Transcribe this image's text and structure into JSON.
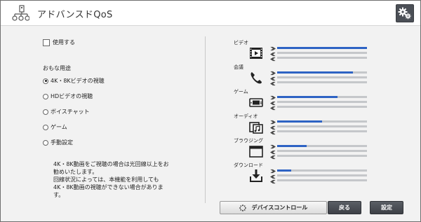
{
  "app": {
    "title": "アドバンスドQoS"
  },
  "settings": {
    "use_label": "使用する"
  },
  "purpose": {
    "title": "おもな用途",
    "options": [
      {
        "label": "4K・8Kビデオの視聴",
        "selected": true
      },
      {
        "label": "HDビデオの視聴",
        "selected": false
      },
      {
        "label": "ボイスチャット",
        "selected": false
      },
      {
        "label": "ゲーム",
        "selected": false
      },
      {
        "label": "手動設定",
        "selected": false
      }
    ]
  },
  "note": {
    "lines": [
      "4K・8K動画をご視聴の場合は光回線以上をお",
      "勧めいたします。",
      "回線状況によっては、本機能を利用しても",
      "4K・8K動画の視聴ができない場合がありま",
      "す。"
    ]
  },
  "categories": [
    {
      "label": "ビデオ",
      "icon": "video-icon",
      "level": 1.0
    },
    {
      "label": "会議",
      "icon": "phone-icon",
      "level": 0.84
    },
    {
      "label": "ゲーム",
      "icon": "game-icon",
      "level": 0.67
    },
    {
      "label": "オーディオ",
      "icon": "audio-icon",
      "level": 0.5
    },
    {
      "label": "ブラウジング",
      "icon": "browser-icon",
      "level": 0.33
    },
    {
      "label": "ダウンロード",
      "icon": "download-icon",
      "level": 0.16
    }
  ],
  "buttons": {
    "device_control": "デバイスコントロール",
    "back": "戻る",
    "apply": "設定"
  },
  "colors": {
    "accent": "#2e63c4",
    "track": "#c5c7ca",
    "button_dark": "#4b4f56"
  }
}
